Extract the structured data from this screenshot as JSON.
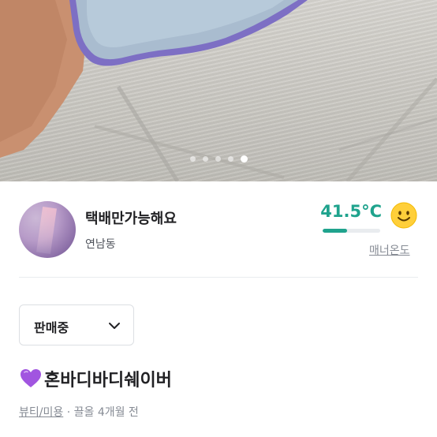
{
  "carousel": {
    "slide_count": 5,
    "active_index": 4
  },
  "seller": {
    "nickname": "택배만가능해요",
    "location": "연남동",
    "manner_temp": "41.5°C",
    "manner_temp_fill_percent": 42,
    "manner_label": "매너온도",
    "face_icon": "smile-face-icon"
  },
  "status_select": {
    "selected": "판매중"
  },
  "product": {
    "emoji_icon": "purple-heart-icon",
    "title": "혼바디바디쉐이버",
    "category": "뷰티/미용",
    "separator": "·",
    "bump_label": "끌올 4개월 전"
  },
  "colors": {
    "accent": "#1fa38d",
    "heart": "#a155e0"
  }
}
